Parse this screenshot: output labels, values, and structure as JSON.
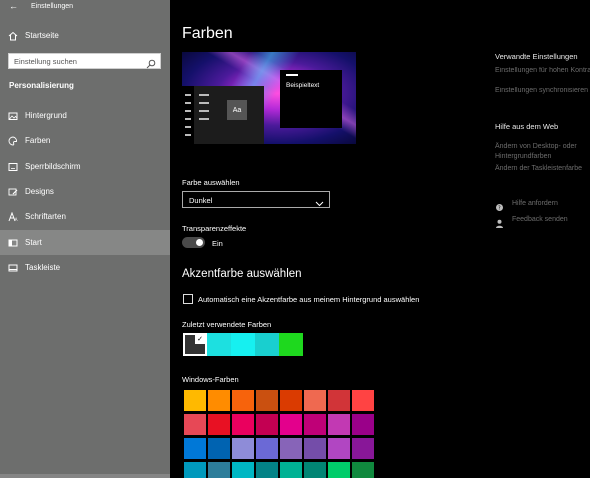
{
  "window": {
    "title": "Einstellungen"
  },
  "sidebar": {
    "home": "Startseite",
    "search_placeholder": "Einstellung suchen",
    "section": "Personalisierung",
    "items": [
      {
        "label": "Hintergrund",
        "icon": "picture-icon",
        "active": false
      },
      {
        "label": "Farben",
        "icon": "palette-icon",
        "active": false
      },
      {
        "label": "Sperrbildschirm",
        "icon": "lockscreen-icon",
        "active": false
      },
      {
        "label": "Designs",
        "icon": "brush-icon",
        "active": false
      },
      {
        "label": "Schriftarten",
        "icon": "font-icon",
        "active": false
      },
      {
        "label": "Start",
        "icon": "start-icon",
        "active": true
      },
      {
        "label": "Taskleiste",
        "icon": "taskbar-icon",
        "active": false
      }
    ]
  },
  "main": {
    "title": "Farben",
    "preview": {
      "sample_text": "Beispieltext",
      "tile_text": "Aa"
    },
    "choose_color_label": "Farbe auswählen",
    "choose_color_value": "Dunkel",
    "transparency_label": "Transparenzeffekte",
    "transparency_state": "Ein",
    "accent_heading": "Akzentfarbe auswählen",
    "auto_accent_label": "Automatisch eine Akzentfarbe aus meinem Hintergrund auswählen",
    "recent_label": "Zuletzt verwendete Farben",
    "windows_colors_label": "Windows-Farben"
  },
  "recent_colors": [
    "#333333",
    "#1de0e0",
    "#16f0f0",
    "#19cfcf",
    "#1ed81e"
  ],
  "windows_colors": [
    "#ffb900",
    "#ff8c00",
    "#f7630c",
    "#ca5010",
    "#da3b01",
    "#ef6950",
    "#d13438",
    "#ff4343",
    "#e74856",
    "#e81123",
    "#ea005e",
    "#c30052",
    "#e3008c",
    "#bf0077",
    "#c239b3",
    "#9a0089",
    "#0078d7",
    "#0063b1",
    "#8e8cd8",
    "#6b69d6",
    "#8764b8",
    "#744da9",
    "#b146c2",
    "#881798",
    "#0099bc",
    "#2d7d9a",
    "#00b7c3",
    "#038387",
    "#00b294",
    "#018574",
    "#00cc6a",
    "#10893e"
  ],
  "related": {
    "heading": "Verwandte Einstellungen",
    "links": [
      "Einstellungen für hohen Kontrast",
      "Einstellungen synchronisieren"
    ]
  },
  "web_help": {
    "heading": "Hilfe aus dem Web",
    "links": [
      "Ändern von Desktop- oder Hintergrundfarben",
      "Ändern der Taskleistenfarbe"
    ]
  },
  "help": {
    "get_help": "Hilfe anfordern",
    "feedback": "Feedback senden"
  }
}
